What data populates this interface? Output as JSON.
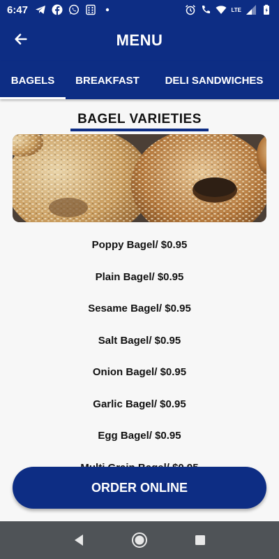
{
  "status_bar": {
    "time": "6:47",
    "left_icons": [
      "telegram-icon",
      "facebook-icon",
      "whatsapp-icon",
      "calculator-icon",
      "dot-icon"
    ],
    "right_icons": [
      "alarm-icon",
      "lte-call-icon",
      "wifi-icon",
      "lte-signal-icon",
      "battery-icon"
    ],
    "lte_label": "LTE"
  },
  "app_bar": {
    "title": "MENU",
    "back_icon": "arrow-left-icon"
  },
  "tabs": [
    {
      "label": "BAGELS",
      "active": true
    },
    {
      "label": "BREAKFAST",
      "active": false
    },
    {
      "label": "DELI SANDWICHES",
      "active": false
    }
  ],
  "section": {
    "title": "BAGEL VARIETIES"
  },
  "menu_items": [
    "Poppy Bagel/ $0.95",
    "Plain Bagel/ $0.95",
    "Sesame Bagel/ $0.95",
    "Salt Bagel/ $0.95",
    "Onion Bagel/ $0.95",
    "Garlic Bagel/ $0.95",
    "Egg Bagel/ $0.95",
    "Multi Grain Bagel/ $0.95"
  ],
  "order_button": {
    "label": "ORDER ONLINE"
  },
  "nav_bar": {
    "icons": [
      "back-triangle-icon",
      "home-circle-icon",
      "recents-square-icon"
    ]
  },
  "colors": {
    "primary": "#0d2d84",
    "nav_bar": "#4f5357",
    "background": "#f7f7f7"
  }
}
